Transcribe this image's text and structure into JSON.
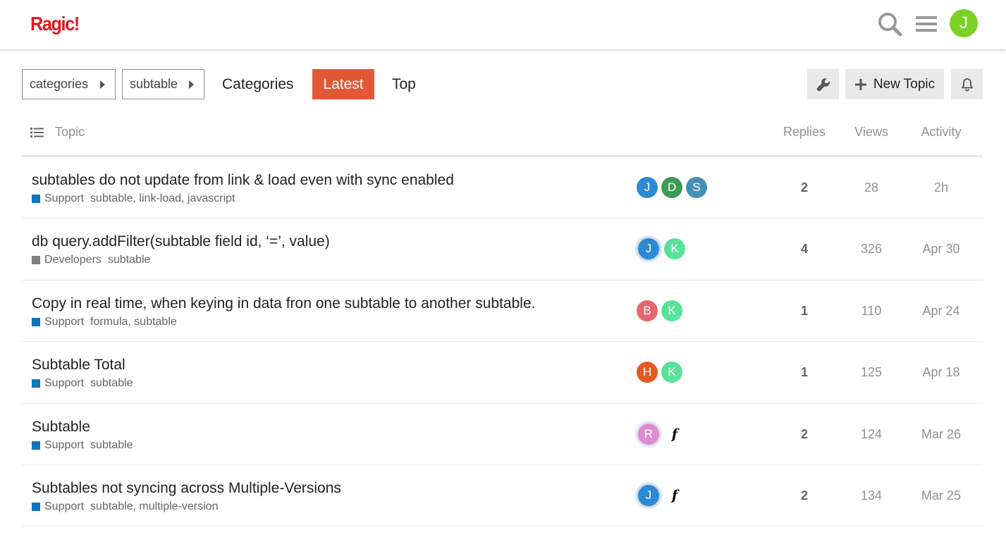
{
  "header": {
    "logo": "Ragic!",
    "avatar_letter": "J",
    "search_icon": "search-icon",
    "menu_icon": "hamburger-icon"
  },
  "nav": {
    "categories_dropdown": "categories",
    "subcategory_dropdown": "subtable",
    "categories_link": "Categories",
    "latest_link": "Latest",
    "top_link": "Top",
    "new_topic_label": "New Topic",
    "wrench_icon": "wrench-icon",
    "bell_icon": "bell-icon"
  },
  "table": {
    "col_topic": "Topic",
    "col_replies": "Replies",
    "col_views": "Views",
    "col_activity": "Activity"
  },
  "colors": {
    "support": "#0e76bd",
    "developers": "#808281",
    "accent": "#e45735"
  },
  "topics": [
    {
      "title": "subtables do not update from link & load even with sync enabled",
      "category": "Support",
      "tags": "subtable, link-load, javascript",
      "posters": [
        "J",
        "D",
        "S"
      ],
      "replies": "2",
      "views": "28",
      "activity": "2h"
    },
    {
      "title": "db query.addFilter(subtable field id, ‘=’, value)",
      "category": "Developers",
      "tags": "subtable",
      "posters": [
        "J",
        "K"
      ],
      "replies": "4",
      "views": "326",
      "activity": "Apr 30"
    },
    {
      "title": "Copy in real time, when keying in data fron one subtable to another subtable.",
      "category": "Support",
      "tags": "formula, subtable",
      "posters": [
        "B",
        "K"
      ],
      "replies": "1",
      "views": "110",
      "activity": "Apr 24"
    },
    {
      "title": "Subtable Total",
      "category": "Support",
      "tags": "subtable",
      "posters": [
        "H",
        "K"
      ],
      "replies": "1",
      "views": "125",
      "activity": "Apr 18"
    },
    {
      "title": "Subtable",
      "category": "Support",
      "tags": "subtable",
      "posters": [
        "R",
        "𝒇"
      ],
      "replies": "2",
      "views": "124",
      "activity": "Mar 26"
    },
    {
      "title": "Subtables not syncing across Multiple-Versions",
      "category": "Support",
      "tags": "subtable, multiple-version",
      "posters": [
        "J",
        "𝒇"
      ],
      "replies": "2",
      "views": "134",
      "activity": "Mar 25"
    }
  ]
}
